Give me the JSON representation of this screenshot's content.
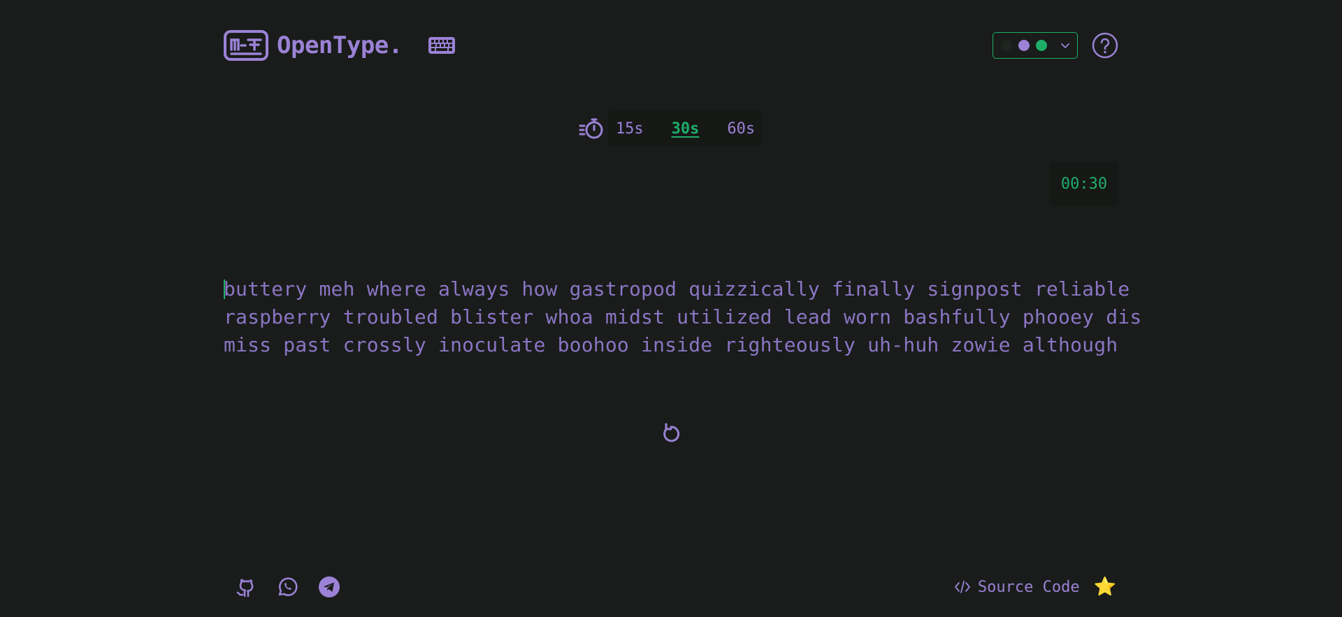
{
  "header": {
    "brand_name": "OpenType.",
    "theme_dots": [
      "#1e2420",
      "#9b82d6",
      "#1fae6a"
    ]
  },
  "time_selector": {
    "options": [
      {
        "label": "15s",
        "active": false
      },
      {
        "label": "30s",
        "active": true
      },
      {
        "label": "60s",
        "active": false
      }
    ]
  },
  "timer": {
    "value": "00:30"
  },
  "words": {
    "lines": [
      "buttery meh where always how gastropod quizzically finally signpost reliable",
      "raspberry troubled blister whoa midst utilized lead worn bashfully phooey dis",
      "miss past crossly inoculate boohoo inside righteously uh-huh zowie although"
    ]
  },
  "footer": {
    "source_label": "Source Code",
    "star": "⭐"
  },
  "colors": {
    "background": "#191c1a",
    "accent": "#9b82d6",
    "highlight": "#1fae6a"
  }
}
